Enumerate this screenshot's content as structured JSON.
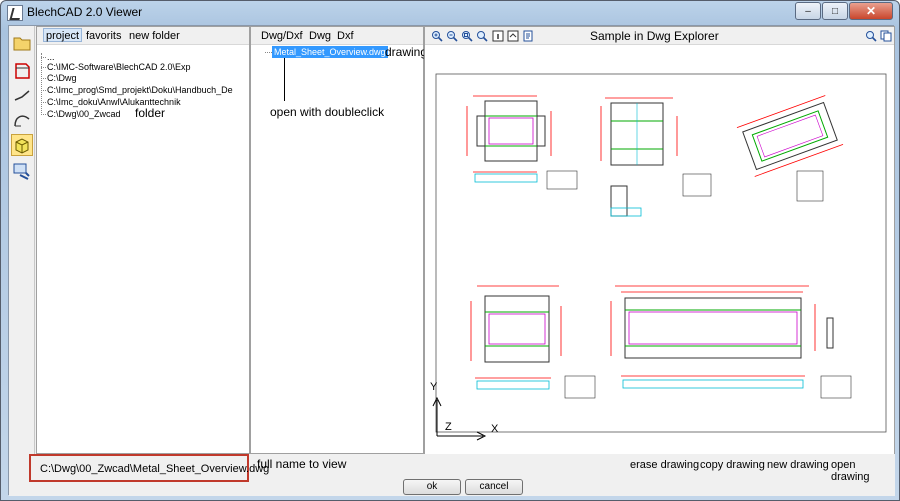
{
  "window": {
    "title": "BlechCAD 2.0 Viewer",
    "minimize": "–",
    "maximize": "□",
    "close": "✕"
  },
  "toolbar_left": {
    "icons": [
      "folder-icon",
      "sheet-outline-icon",
      "bend-line-icon",
      "curve-icon",
      "box-3d-icon",
      "settings-tools-icon"
    ],
    "active_index": 4
  },
  "left_panel": {
    "tabs": [
      "project",
      "favorits",
      "new folder"
    ],
    "selected_tab": "project",
    "items": [
      "...",
      "C:\\IMC-Software\\BlechCAD 2.0\\Exp",
      "C:\\Dwg",
      "C:\\Imc_prog\\Smd_projekt\\Doku\\Handbuch_De",
      "C:\\Imc_doku\\Anwl\\Alukanttechnik",
      "C:\\Dwg\\00_Zwcad"
    ],
    "annotation": "folder"
  },
  "middle_panel": {
    "tabs": [
      "Dwg/Dxf",
      "Dwg",
      "Dxf"
    ],
    "selected_file": "Metal_Sheet_Overview.dwg",
    "annotation_drawing": "drawing",
    "annotation_open": "open with doubleclick"
  },
  "right_panel": {
    "title": "Sample in Dwg Explorer",
    "toolbar_icons": [
      "zoom-in-icon",
      "zoom-out-icon",
      "zoom-window-icon",
      "zoom-extents-icon",
      "info-icon",
      "layer-icon",
      "print-icon"
    ],
    "right_icons": [
      "zoom-search-icon",
      "copy-icon"
    ],
    "axis_y": "Y",
    "axis_z": "Z",
    "axis_x": "X"
  },
  "bottom": {
    "full_name": "C:\\Dwg\\00_Zwcad\\Metal_Sheet_Overview.dwg",
    "full_name_annotation": "full name to view",
    "links": [
      "erase drawing",
      "copy drawing",
      "new drawing",
      "open drawing"
    ],
    "ok": "ok",
    "cancel": "cancel"
  },
  "colors": {
    "accent_red": "#c0392b",
    "selection_blue": "#3399ff",
    "cad_green": "#00aa00",
    "cad_magenta": "#cc00cc",
    "cad_red": "#ff0000",
    "cad_cyan": "#00bcd4"
  }
}
